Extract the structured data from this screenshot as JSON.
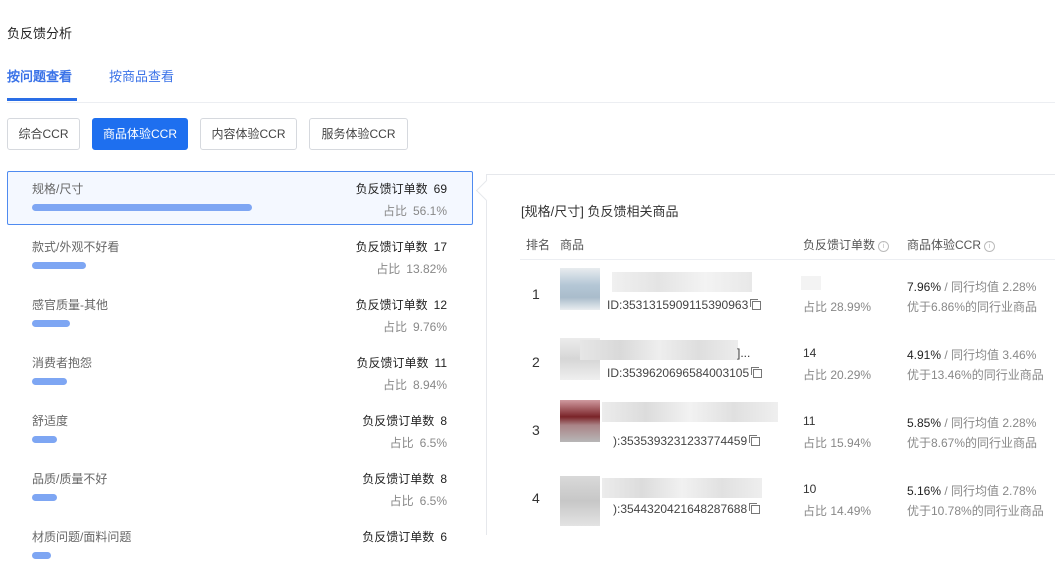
{
  "page_title": "负反馈分析",
  "tabs": [
    {
      "label": "按问题查看",
      "active": true
    },
    {
      "label": "按商品查看",
      "active": false
    }
  ],
  "segments": [
    {
      "label": "综合CCR",
      "active": false
    },
    {
      "label": "商品体验CCR",
      "active": true
    },
    {
      "label": "内容体验CCR",
      "active": false
    },
    {
      "label": "服务体验CCR",
      "active": false
    }
  ],
  "issue_count_label": "负反馈订单数",
  "issue_share_label": "占比",
  "issues": [
    {
      "name": "规格/尺寸",
      "count": "69",
      "share": "56.1%",
      "fraction": 0.561,
      "selected": true
    },
    {
      "name": "款式/外观不好看",
      "count": "17",
      "share": "13.82%",
      "fraction": 0.1382,
      "selected": false
    },
    {
      "name": "感官质量-其他",
      "count": "12",
      "share": "9.76%",
      "fraction": 0.0976,
      "selected": false
    },
    {
      "name": "消费者抱怨",
      "count": "11",
      "share": "8.94%",
      "fraction": 0.0894,
      "selected": false
    },
    {
      "name": "舒适度",
      "count": "8",
      "share": "6.5%",
      "fraction": 0.065,
      "selected": false
    },
    {
      "name": "品质/质量不好",
      "count": "8",
      "share": "6.5%",
      "fraction": 0.065,
      "selected": false
    },
    {
      "name": "材质问题/面料问题",
      "count": "6",
      "share": "",
      "fraction": 0.0488,
      "selected": false
    }
  ],
  "panel": {
    "title": "[规格/尺寸] 负反馈相关商品",
    "columns": {
      "rank": "排名",
      "product": "商品",
      "count": "负反馈订单数",
      "ccr": "商品体验CCR"
    }
  },
  "colors": {
    "accent": "#1e6fef",
    "bar": "#7ea6f3",
    "selected_bg": "#f4f8ff"
  },
  "products": [
    {
      "rank": "1",
      "id": "ID:3531315909115390963",
      "title_fragment": "",
      "count": "",
      "share": "占比 28.99%",
      "ccr": "7.96%",
      "avg": "/  同行均值 2.28%",
      "note": "优于6.86%的同行业商品"
    },
    {
      "rank": "2",
      "id": "ID:3539620696584003105",
      "title_fragment": "]...",
      "count": "14",
      "share": "占比 20.29%",
      "ccr": "4.91%",
      "avg": "/  同行均值 3.46%",
      "note": "优于13.46%的同行业商品"
    },
    {
      "rank": "3",
      "id": "):3535393231233774459",
      "title_fragment": "",
      "count": "11",
      "share": "占比 15.94%",
      "ccr": "5.85%",
      "avg": "/  同行均值 2.28%",
      "note": "优于8.67%的同行业商品"
    },
    {
      "rank": "4",
      "id": "):3544320421648287688",
      "title_fragment": "",
      "count": "10",
      "share": "占比 14.49%",
      "ccr": "5.16%",
      "avg": "/  同行均值 2.78%",
      "note": "优于10.78%的同行业商品"
    }
  ]
}
